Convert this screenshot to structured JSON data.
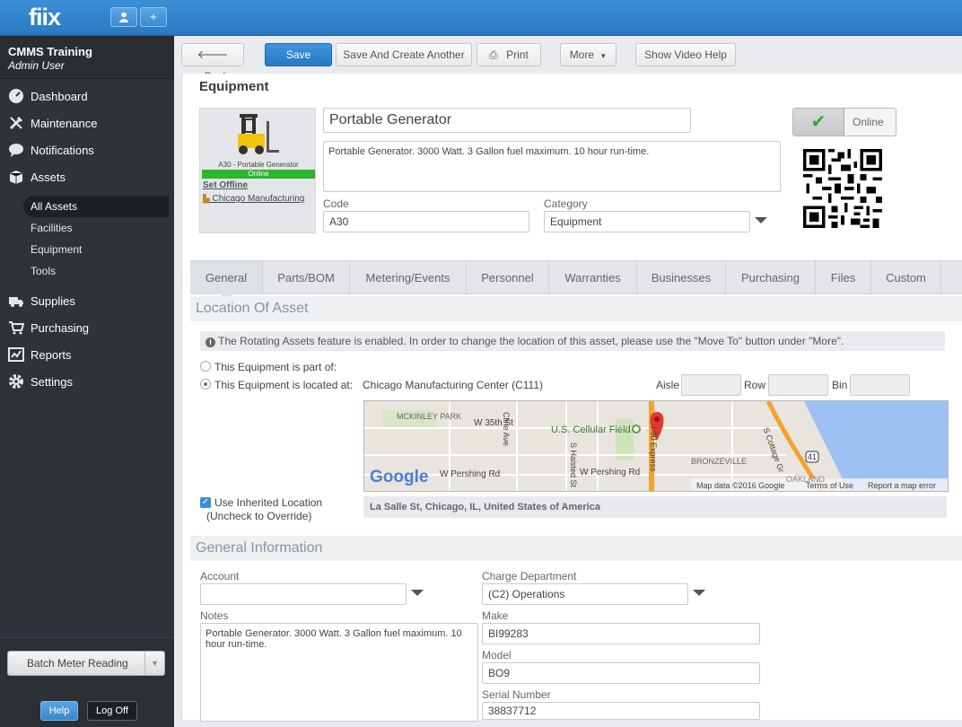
{
  "app": {
    "logo": "fiix",
    "user_icon": "user-icon",
    "add_label": "+"
  },
  "sidebar": {
    "org": "CMMS Training",
    "user": "Admin User",
    "items": [
      {
        "label": "Dashboard",
        "icon": "dashboard-icon"
      },
      {
        "label": "Maintenance",
        "icon": "wrench-icon"
      },
      {
        "label": "Notifications",
        "icon": "chat-bubble-icon"
      },
      {
        "label": "Assets",
        "icon": "box-icon"
      }
    ],
    "subitems": [
      "All Assets",
      "Facilities",
      "Equipment",
      "Tools"
    ],
    "items2": [
      {
        "label": "Supplies",
        "icon": "truck-icon"
      },
      {
        "label": "Purchasing",
        "icon": "cart-icon"
      },
      {
        "label": "Reports",
        "icon": "chart-icon"
      },
      {
        "label": "Settings",
        "icon": "gear-icon"
      }
    ],
    "batch_label": "Batch Meter Reading",
    "help_label": "Help",
    "logoff_label": "Log Off"
  },
  "toolbar": {
    "back": "Back",
    "save": "Save",
    "save_another": "Save And Create Another",
    "print": "Print",
    "more": "More",
    "video_help": "Show Video Help"
  },
  "page": {
    "title": "Equipment",
    "card_code": "A30 - Portable Generator",
    "card_status": "Online",
    "set_offline": "Set Offline",
    "card_location": "Chicago Manufacturing",
    "name": "Portable Generator",
    "description": "Portable Generator. 3000 Watt. 3 Gallon fuel maximum. 10 hour run-time.",
    "code_label": "Code",
    "code": "A30",
    "category_label": "Category",
    "category": "Equipment",
    "online_label": "Online"
  },
  "tabs": [
    "General",
    "Parts/BOM",
    "Metering/Events",
    "Personnel",
    "Warranties",
    "Businesses",
    "Purchasing",
    "Files",
    "Custom"
  ],
  "location": {
    "title": "Location Of Asset",
    "info": "The Rotating Assets feature is enabled. In order to change the location of this asset, please use the \"Move To\" button under \"More\".",
    "part_of": "This Equipment is part of:",
    "located_at": "This Equipment is located at:",
    "site": "Chicago Manufacturing Center (C111)",
    "aisle": "Aisle",
    "row": "Row",
    "bin": "Bin",
    "inherited": "Use Inherited Location",
    "uncheck": "(Uncheck to Override)",
    "address": "La Salle St, Chicago, IL, United States of America",
    "map": {
      "mckinley": "MCKINLEY PARK",
      "w35": "W 35th St",
      "cellular": "U.S. Cellular Field",
      "pershing1": "W Pershing Rd",
      "pershing2": "W Pershing Rd",
      "bronzeville": "BRONZEVILLE",
      "halsted": "S Halsted St",
      "cottage": "S Cottage Gr",
      "express": "I-90 Express",
      "hwy": "41",
      "oakland": "OAKLAND",
      "cline": "Cline Ave",
      "google": "Google",
      "mapdata": "Map data ©2016 Google",
      "terms": "Terms of Use",
      "report": "Report a map error"
    }
  },
  "general": {
    "title": "General Information",
    "account_label": "Account",
    "account": "",
    "charge_label": "Charge Department",
    "charge": "(C2) Operations",
    "notes_label": "Notes",
    "notes": "Portable Generator. 3000 Watt. 3 Gallon fuel maximum. 10 hour run-time.",
    "make_label": "Make",
    "make": "BI99283",
    "model_label": "Model",
    "model": "BO9",
    "serial_label": "Serial Number",
    "serial": "38837712"
  }
}
